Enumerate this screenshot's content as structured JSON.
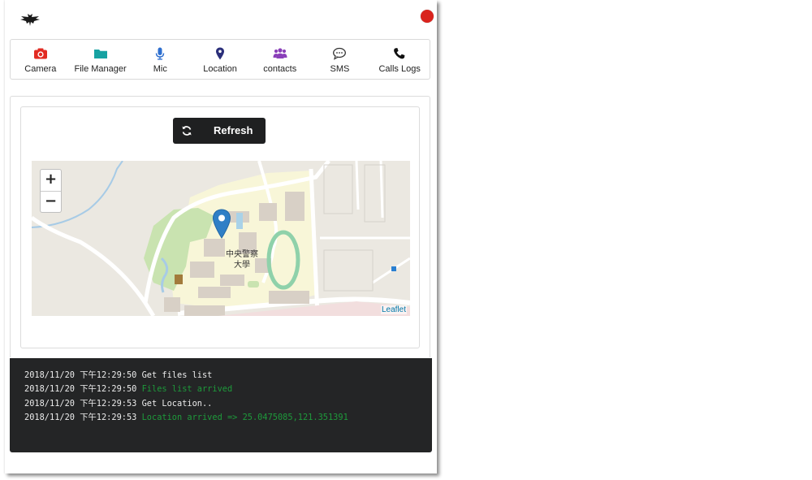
{
  "window": {
    "close_color": "#d9231d"
  },
  "toolbar": {
    "items": [
      {
        "label": "Camera",
        "icon": "camera-icon",
        "color": "#e22b22"
      },
      {
        "label": "File Manager",
        "icon": "folder-icon",
        "color": "#17a2a2"
      },
      {
        "label": "Mic",
        "icon": "microphone-icon",
        "color": "#2e6fcf"
      },
      {
        "label": "Location",
        "icon": "map-marker-icon",
        "color": "#2b2f7a"
      },
      {
        "label": "contacts",
        "icon": "users-icon",
        "color": "#8a3fb9"
      },
      {
        "label": "SMS",
        "icon": "chat-bubble-icon",
        "color": "#333333"
      },
      {
        "label": "Calls Logs",
        "icon": "phone-icon",
        "color": "#111111"
      }
    ]
  },
  "location_panel": {
    "refresh_label": "Refresh",
    "refresh_icon": "refresh-icon",
    "map": {
      "zoom_in": "+",
      "zoom_out": "−",
      "place_label_line1": "中央警察",
      "place_label_line2": "大學",
      "attribution": "Leaflet",
      "marker_icon": "map-pin-icon",
      "marker_color": "#2f7fc6"
    }
  },
  "console": {
    "lines": [
      {
        "timestamp": "2018/11/20 下午12:29:50",
        "message": "Get files list",
        "color": "#ececec"
      },
      {
        "timestamp": "2018/11/20 下午12:29:50",
        "message": "Files list arrived",
        "color": "#1e9a3b"
      },
      {
        "timestamp": "2018/11/20 下午12:29:53",
        "message": "Get Location..",
        "color": "#ececec"
      },
      {
        "timestamp": "2018/11/20 下午12:29:53",
        "message": "Location arrived => 25.0475085,121.351391",
        "color": "#1e9a3b"
      }
    ]
  }
}
